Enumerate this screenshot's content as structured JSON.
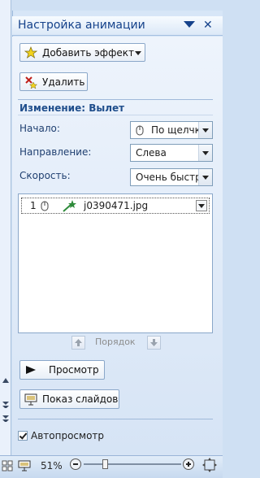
{
  "pane": {
    "title": "Настройка анимации",
    "add_effect_label": "Добавить эффект",
    "delete_label": "Удалить"
  },
  "change": {
    "section_title": "Изменение: Вылет",
    "start_label": "Начало:",
    "start_value": "По щелчку",
    "direction_label": "Направление:",
    "direction_value": "Слева",
    "speed_label": "Скорость:",
    "speed_value": "Очень быстро"
  },
  "effects_list": {
    "items": [
      {
        "index": "1",
        "name": "j0390471.jpg"
      }
    ]
  },
  "order": {
    "label": "Порядок"
  },
  "actions": {
    "preview_label": "Просмотр",
    "slideshow_label": "Показ слайдов"
  },
  "autopreview": {
    "label": "Автопросмотр",
    "checked": true
  },
  "statusbar": {
    "zoom": "51%"
  },
  "colors": {
    "accent": "#15428b",
    "pane_bg": "#dfeaf8",
    "border": "#8aa7c9",
    "green_effect": "#2e8b3a"
  }
}
